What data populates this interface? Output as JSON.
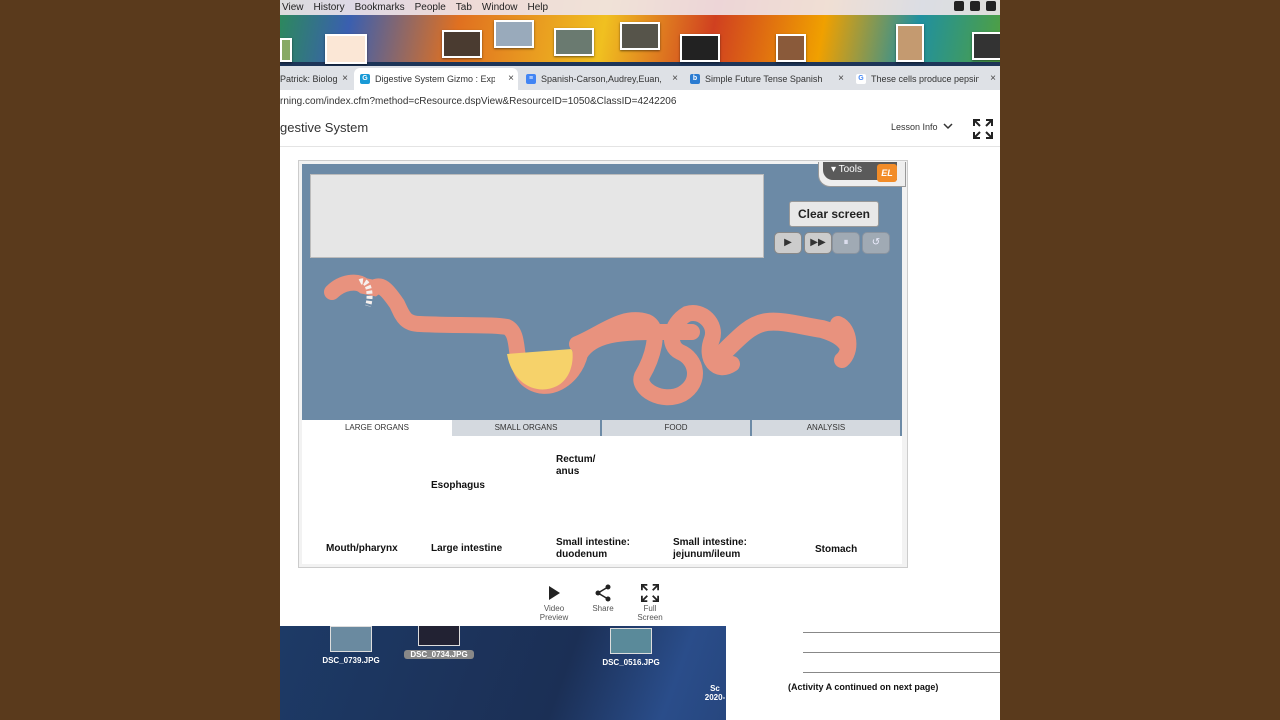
{
  "menubar": {
    "items": [
      "View",
      "History",
      "Bookmarks",
      "People",
      "Tab",
      "Window",
      "Help"
    ]
  },
  "tabs": [
    {
      "title": "Patrick: Biolog",
      "favicon": "classroom-icon",
      "color": "#f4b400"
    },
    {
      "title": "Digestive System Gizmo : Explo",
      "favicon": "gizmos-icon",
      "color": "#1a9ad6",
      "active": true
    },
    {
      "title": "Spanish-Carson,Audrey,Euan,",
      "favicon": "docs-icon",
      "color": "#4285f4"
    },
    {
      "title": "Simple Future Tense Spanish",
      "favicon": "bitly-icon",
      "color": "#2a7bd1"
    },
    {
      "title": "These cells produce pepsin, wh",
      "favicon": "google-icon",
      "color": "#ffffff"
    }
  ],
  "close_glyph": "×",
  "address": {
    "url": "rning.com/index.cfm?method=cResource.dspView&ResourceID=1050&ClassID=4242206"
  },
  "page": {
    "title": "gestive System",
    "lesson_info": "Lesson Info"
  },
  "gizmo": {
    "tools_label": "Tools",
    "logo_text": "EL",
    "clear_button": "Clear screen",
    "controls": {
      "play": "▶",
      "fast_forward": "▶▶",
      "pause": "⏸",
      "reset": "↺"
    },
    "tabs": [
      "LARGE ORGANS",
      "SMALL ORGANS",
      "FOOD",
      "ANALYSIS"
    ],
    "active_tab": "LARGE ORGANS",
    "organs": {
      "mouth": "Mouth/pharynx",
      "esophagus": "Esophagus",
      "large_intestine": "Large intestine",
      "rectum_line1": "Rectum/",
      "rectum_line2": "anus",
      "duodenum_line1": "Small intestine:",
      "duodenum_line2": "duodenum",
      "jejunum_line1": "Small intestine:",
      "jejunum_line2": "jejunum/ileum",
      "stomach": "Stomach"
    }
  },
  "bottom_bar": {
    "video_preview_line1": "Video",
    "video_preview_line2": "Preview",
    "share": "Share",
    "full_screen_line1": "Full",
    "full_screen_line2": "Screen"
  },
  "desktop": {
    "files": [
      "DSC_0739.JPG",
      "DSC_0734.JPG",
      "DSC_0516.JPG",
      "Sc",
      "2020-"
    ],
    "doc_text": "(Activity A continued on next page)"
  },
  "colors": {
    "sim_background": "#6c8aa6",
    "organ_fill": "#e8927e",
    "stomach_contents": "#f6d26a"
  }
}
